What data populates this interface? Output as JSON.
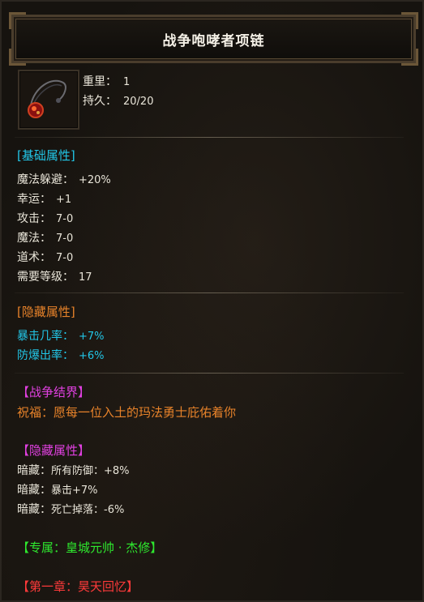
{
  "title": "战争咆哮者项链",
  "item": {
    "weight_label": "重里：",
    "weight_value": "1",
    "durability_label": "持久：",
    "durability_value": "20/20"
  },
  "basic": {
    "header": "[基础属性]",
    "rows": [
      {
        "label": "魔法躲避：",
        "value": "+20%"
      },
      {
        "label": "幸运：",
        "value": "+1"
      },
      {
        "label": "攻击：",
        "value": "7-0"
      },
      {
        "label": "魔法：",
        "value": "7-0"
      },
      {
        "label": "道术：",
        "value": "7-0"
      },
      {
        "label": "需要等级：",
        "value": "17"
      }
    ]
  },
  "hidden": {
    "header": "[隐藏属性]",
    "rows": [
      {
        "label": "暴击几率：",
        "value": "+7%"
      },
      {
        "label": "防爆出率：",
        "value": "+6%"
      }
    ]
  },
  "war_realm": {
    "header": "【战争结界】",
    "blessing": "祝福：愿每一位入土的玛法勇士庇佑着你"
  },
  "hidden2": {
    "header": "【隐藏属性】",
    "rows": [
      {
        "label": "暗藏：",
        "value": "所有防御：+8%"
      },
      {
        "label": "暗藏：",
        "value": "暴击+7%"
      },
      {
        "label": "暗藏：",
        "value": "死亡掉落：-6%"
      }
    ]
  },
  "exclusive": "【专属：皇城元帅 · 杰修】",
  "chapter": "【第一章：昊天回忆】",
  "colors": {
    "cyan": "#22c7e8",
    "orange": "#e8832a",
    "magenta": "#e040e0",
    "green": "#2ee82e",
    "red": "#ff3a3a"
  },
  "icons": {
    "item": "necklace-icon"
  }
}
